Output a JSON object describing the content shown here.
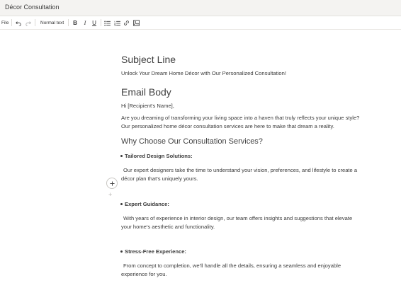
{
  "window": {
    "title": "Décor Consultation"
  },
  "toolbar": {
    "file_label": "File",
    "style_label": "Normal text"
  },
  "doc": {
    "subject_heading": "Subject Line",
    "subject_text": "Unlock Your Dream Home Décor with Our Personalized Consultation!",
    "body_heading": "Email Body",
    "greeting": "Hi [Recipient's Name],",
    "intro_line1": "Are you dreaming of transforming your living space into a haven that truly reflects your unique style?",
    "intro_line2": "Our personalized home décor consultation services are here to make that dream a reality.",
    "section_heading": "Why Choose Our Consultation Services?",
    "items": [
      {
        "title": "Tailored Design Solutions:",
        "line1": "Our expert designers take the time to understand your vision, preferences, and lifestyle to create a",
        "line2": "décor plan that's uniquely yours."
      },
      {
        "title": "Expert Guidance:",
        "line1": "With years of experience in interior design, our team offers insights and suggestions that elevate",
        "line2": "your home's aesthetic and functionality."
      },
      {
        "title": "Stress-Free Experience:",
        "line1": "From concept to completion, we'll handle all the details, ensuring a seamless and enjoyable",
        "line2": "experience for you."
      }
    ]
  },
  "icons": {
    "undo": "undo-icon",
    "redo": "redo-icon",
    "bold": "bold-icon",
    "italic": "italic-icon",
    "underline": "underline-icon",
    "bullet_list": "bullet-list-icon",
    "numbered_list": "numbered-list-icon",
    "link": "link-icon",
    "image": "image-icon",
    "add": "plus-icon"
  }
}
